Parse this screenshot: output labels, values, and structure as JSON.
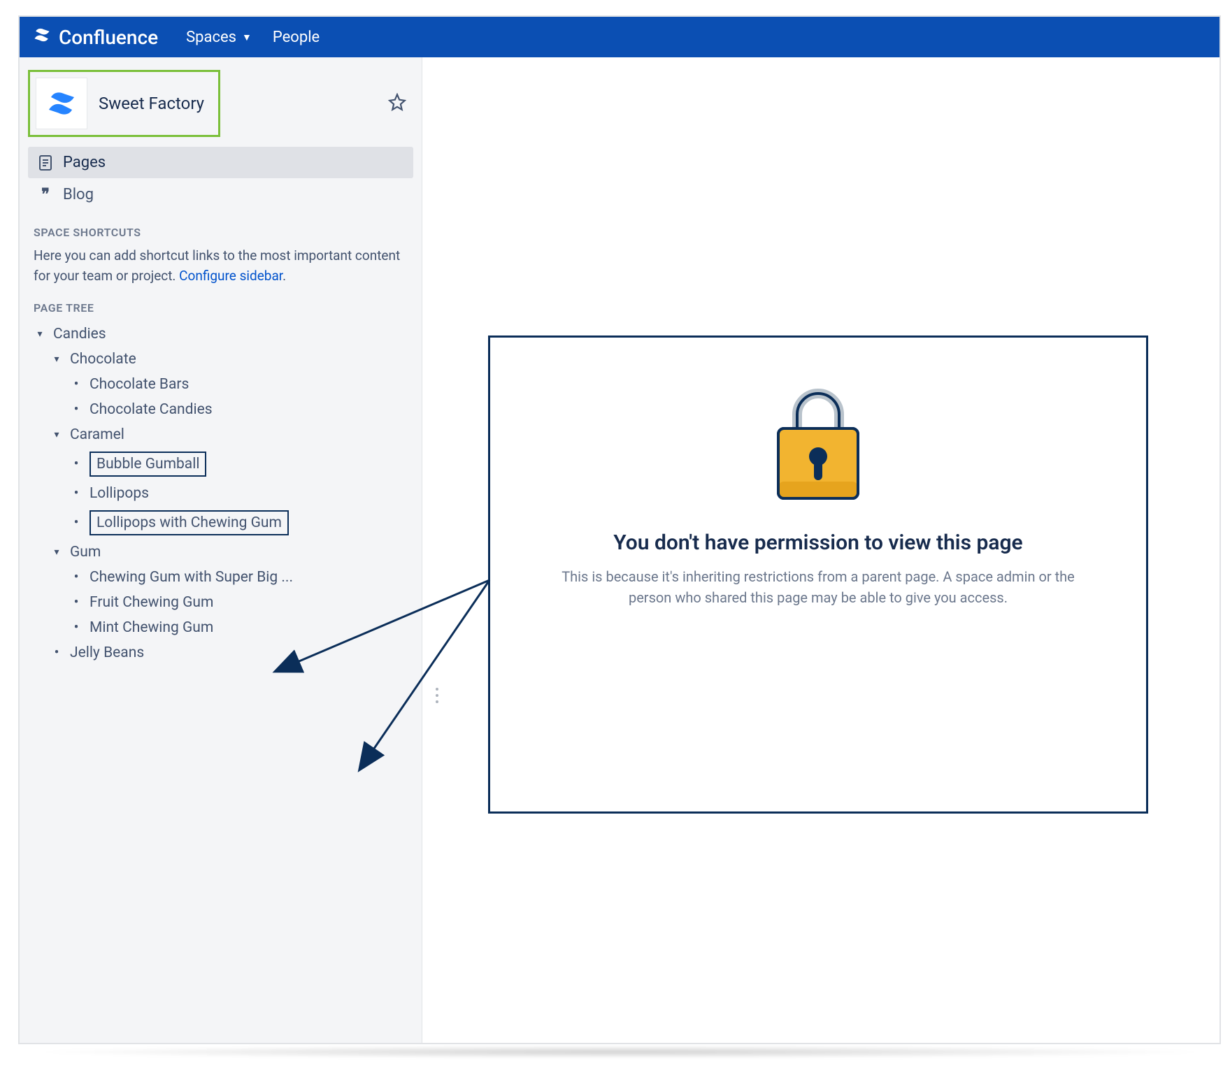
{
  "branding": {
    "product": "Confluence"
  },
  "topnav": {
    "spaces": "Spaces",
    "people": "People"
  },
  "space": {
    "name": "Sweet Factory"
  },
  "nav": {
    "pages": "Pages",
    "blog": "Blog"
  },
  "shortcuts": {
    "heading": "SPACE SHORTCUTS",
    "text": "Here you can add shortcut links to the most important content for your team or project. ",
    "link": "Configure sidebar"
  },
  "tree": {
    "heading": "PAGE TREE",
    "candies": "Candies",
    "chocolate": "Chocolate",
    "chocolate_bars": "Chocolate Bars",
    "chocolate_candies": "Chocolate Candies",
    "caramel": "Caramel",
    "bubble_gumball": "Bubble Gumball",
    "lollipops": "Lollipops",
    "lollipops_gum": "Lollipops with Chewing Gum",
    "gum": "Gum",
    "gum_super": "Chewing Gum with Super Big ...",
    "gum_fruit": "Fruit Chewing Gum",
    "gum_mint": "Mint Chewing Gum",
    "jelly": "Jelly Beans"
  },
  "permission": {
    "title": "You don't have permission to view this page",
    "desc": "This is because it's inheriting restrictions from a parent page. A space admin or the person who shared this page may be able to give you access."
  },
  "colors": {
    "topbar": "#0b4fb3",
    "highlight_border": "#7abf39",
    "annotation": "#0b2e59",
    "link": "#0052cc"
  }
}
